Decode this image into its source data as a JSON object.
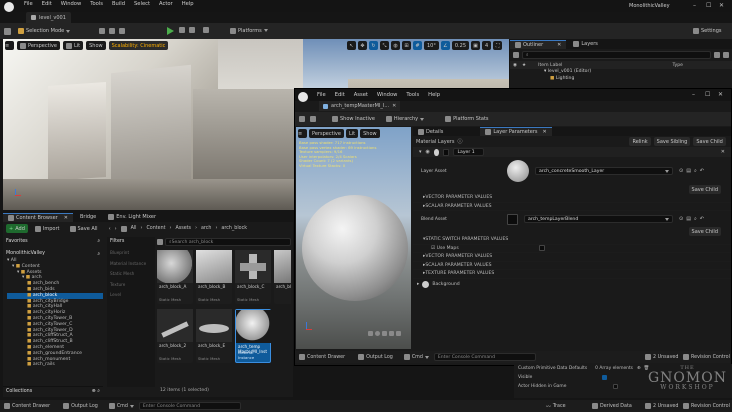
{
  "main": {
    "menu": [
      "File",
      "Edit",
      "Window",
      "Tools",
      "Build",
      "Select",
      "Actor",
      "Help"
    ],
    "project": "MonolithicValley",
    "level_tab": "level_v001",
    "toolbar": {
      "mode": "Selection Mode",
      "platforms": "Platforms",
      "settings": "Settings"
    },
    "viewport": {
      "perspective": "Perspective",
      "lit": "Lit",
      "show": "Show",
      "scalability": "Scalability: Cinematic",
      "snap_angle": "10°",
      "snap_scale": "0.25",
      "camera": "4"
    },
    "outliner": {
      "tab": "Outliner",
      "layers": "Layers",
      "col_label": "Item Label",
      "col_type": "Type",
      "items": [
        "level_v001 (Editor)",
        "Lighting"
      ]
    },
    "content_browser": {
      "tab": "Content Browser",
      "tab2": "Bridge",
      "tab3": "Env. Light Mixer",
      "add": "Add",
      "import": "Import",
      "save_all": "Save All",
      "path": [
        "All",
        "Content",
        "Assets",
        "arch",
        "arch_block"
      ],
      "favorites": "Favorites",
      "root": "MonolithicValley",
      "filters": "Filters",
      "filter_items": [
        "Blueprint",
        "Material Instance",
        "Static Mesh",
        "Texture",
        "Level"
      ],
      "search": "Search arch_block",
      "tree": [
        "All",
        "Content",
        "Assets",
        "arch",
        "arch_bench",
        "arch_bids",
        "arch_block",
        "arch_cityBridge",
        "arch_cityHall",
        "arch_cityHoriz",
        "arch_cityTower_B",
        "arch_cityTower_C",
        "arch_cityTower_D",
        "arch_cliffStruct_A",
        "arch_cliffStruct_B",
        "arch_element",
        "arch_groundEntrance",
        "arch_monument",
        "arch_rails"
      ],
      "assets": [
        {
          "name": "arch_block_A",
          "type": "Static Mesh"
        },
        {
          "name": "arch_block_B",
          "type": "Static Mesh"
        },
        {
          "name": "arch_block_C",
          "type": "Static Mesh"
        },
        {
          "name": "arch_bl",
          "type": ""
        },
        {
          "name": "arch_block_2",
          "type": "Static Mesh"
        },
        {
          "name": "arch_block_E",
          "type": "Static Mesh"
        },
        {
          "name": "arch_temp MasterMI_Inst",
          "type": "Material Instance"
        }
      ],
      "status": "12 items (1 selected)",
      "collections": "Collections"
    },
    "bottom": {
      "drawer": "Content Drawer",
      "output": "Output Log",
      "cmd": "Cmd",
      "console": "Enter Console Command",
      "trace": "Trace",
      "derived": "Derived Data",
      "unsaved": "2 Unsaved",
      "revision": "Revision Control"
    }
  },
  "mat": {
    "menu": [
      "File",
      "Edit",
      "Asset",
      "Window",
      "Tools",
      "Help"
    ],
    "tab": "arch_tempMasterMI_I...",
    "toolbar": {
      "inactive": "Show Inactive",
      "hierarchy": "Hierarchy",
      "platform": "Platform Stats"
    },
    "viewport": {
      "perspective": "Perspective",
      "lit": "Lit",
      "show": "Show",
      "stats": [
        "Base pass shader: 717 instructions",
        "Base pass vertex shader: 69 instructions",
        "Texture samplers: 9/16",
        "User interpolators: 2/4 Scalars",
        "Shader Count: 7 (2 variants)",
        "Virtual Texture Stacks: 0"
      ]
    },
    "details_tab": "Details",
    "layer_tab": "Layer Parameters",
    "material_layers": "Material Layers",
    "relink": "Relink",
    "save_sibling": "Save Sibling",
    "save_child": "Save Child",
    "layer_name": "Layer 1",
    "layer_asset_label": "Layer Asset",
    "layer_asset": "arch_concreteSmooth_Layer",
    "vector": "VECTOR PARAMETER VALUES",
    "scalar": "SCALAR PARAMETER VALUES",
    "blend_label": "Blend Asset",
    "blend_asset": "arch_tempLayerBlend",
    "static": "STATIC SWITCH PARAMETER VALUES",
    "use_maps": "Use Maps",
    "texture": "TEXTURE PARAMETER VALUES",
    "background": "Background",
    "bottom_drawer": "Content Drawer",
    "bottom_output": "Output Log",
    "bottom_cmd": "Cmd",
    "bottom_console": "Enter Console Command",
    "bottom_unsaved": "2 Unsaved",
    "bottom_revision": "Revision Control",
    "custom_prim": "Custom Primitive Data Defaults",
    "array": "0 Array elements",
    "visible": "Visible",
    "hidden": "Actor Hidden in Game"
  },
  "watermark": {
    "line1": "THE",
    "line2": "GNOMON",
    "line3": "WORKSHOP"
  }
}
